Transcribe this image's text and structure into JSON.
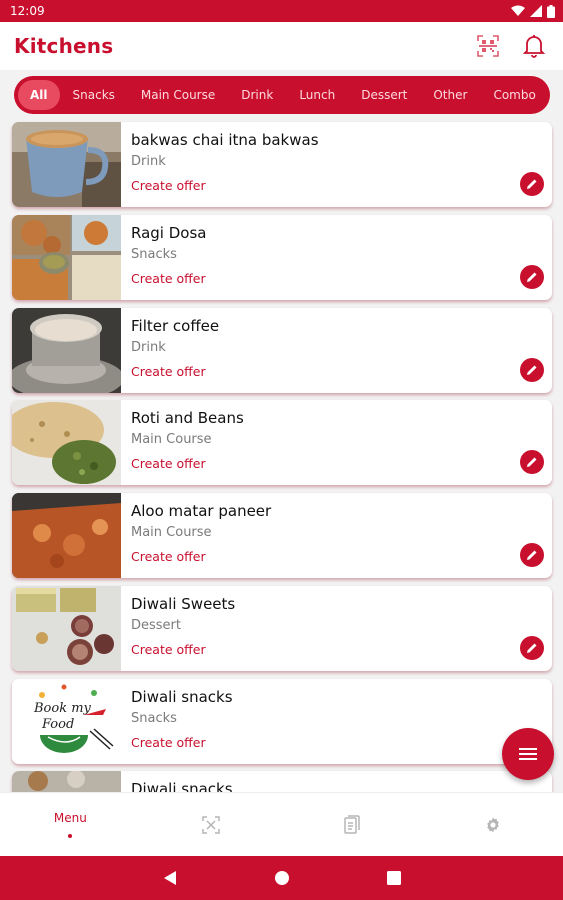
{
  "status_bar": {
    "time": "12:09"
  },
  "app_bar": {
    "title": "Kitchens",
    "icons": [
      "qr-scan-icon",
      "bell-icon"
    ]
  },
  "categories": {
    "selected": "All",
    "items": [
      "All",
      "Snacks",
      "Main Course",
      "Drink",
      "Lunch",
      "Dessert",
      "Other",
      "Combo"
    ]
  },
  "items": [
    {
      "name": "bakwas chai itna bakwas",
      "category": "Drink",
      "action": "Create offer"
    },
    {
      "name": "Ragi Dosa",
      "category": "Snacks",
      "action": "Create offer"
    },
    {
      "name": "Filter coffee",
      "category": "Drink",
      "action": "Create offer"
    },
    {
      "name": "Roti and Beans",
      "category": "Main Course",
      "action": "Create offer"
    },
    {
      "name": "Aloo matar paneer",
      "category": "Main Course",
      "action": "Create offer"
    },
    {
      "name": "Diwali Sweets",
      "category": "Dessert",
      "action": "Create offer"
    },
    {
      "name": "Diwali snacks",
      "category": "Snacks",
      "action": "Create offer",
      "image_text": "Book my Food"
    },
    {
      "name": "Diwali snacks",
      "category": "",
      "action": ""
    }
  ],
  "bottom_nav": {
    "items": [
      {
        "label": "Menu",
        "icon": "menu-icon",
        "active": true
      },
      {
        "label": "",
        "icon": "scan-icon"
      },
      {
        "label": "",
        "icon": "orders-icon"
      },
      {
        "label": "",
        "icon": "settings-icon"
      }
    ]
  },
  "colors": {
    "primary": "#c8102e",
    "chip_active": "#e84a5f"
  }
}
